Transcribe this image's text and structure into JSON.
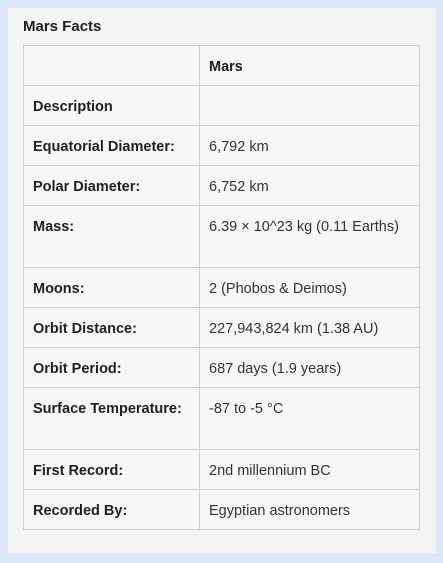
{
  "card": {
    "title": "Mars Facts"
  },
  "table": {
    "header": {
      "col1": "",
      "col2": "Mars"
    },
    "rows": [
      {
        "label": "Description",
        "value": ""
      },
      {
        "label": "Equatorial Diameter:",
        "value": "6,792 km"
      },
      {
        "label": "Polar Diameter:",
        "value": "6,752 km"
      },
      {
        "label": "Mass:",
        "value": "6.39 × 10^23 kg (0.11 Earths)"
      },
      {
        "label": "Moons:",
        "value": "2 (Phobos & Deimos)"
      },
      {
        "label": "Orbit Distance:",
        "value": "227,943,824 km (1.38 AU)"
      },
      {
        "label": "Orbit Period:",
        "value": "687 days (1.9 years)"
      },
      {
        "label": "Surface Temperature:",
        "value": "-87 to -5 °C"
      },
      {
        "label": "First Record:",
        "value": "2nd millennium BC"
      },
      {
        "label": "Recorded By:",
        "value": "Egyptian astronomers"
      }
    ]
  },
  "colors": {
    "page_background": "#dce7f8",
    "card_background": "#f4f4f4",
    "table_border": "#cfcfcf",
    "table_outer_border": "#777777"
  }
}
